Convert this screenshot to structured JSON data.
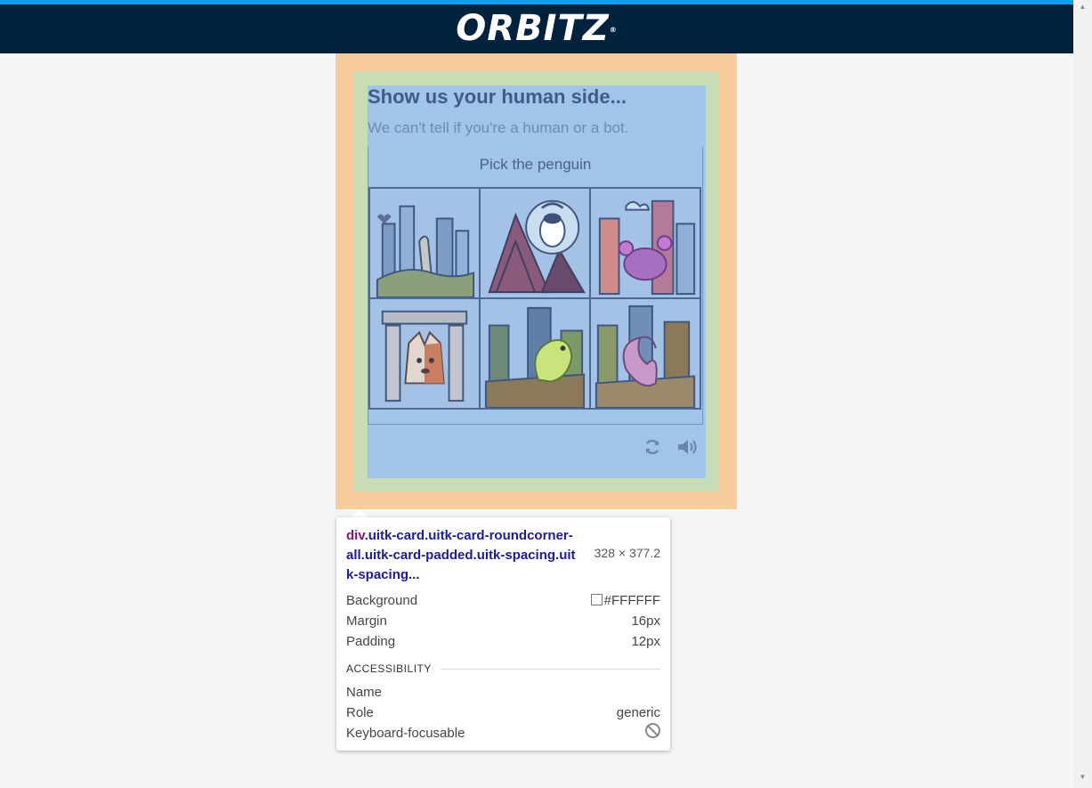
{
  "header": {
    "logo_text": "ORBITZ",
    "logo_mark": "®",
    "bg_color": "#00223c",
    "accent_color": "#0a9ef0"
  },
  "captcha": {
    "title": "Show us your human side...",
    "subtitle": "We can't tell if you're a human or a bot.",
    "prompt": "Pick the penguin",
    "tiles": [
      "tile-1",
      "tile-2",
      "tile-3",
      "tile-4",
      "tile-5",
      "tile-6"
    ],
    "reload_icon": "reload-icon",
    "audio_icon": "audio-icon"
  },
  "overlay": {
    "margin_color": "#f7cc9d",
    "padding_color": "#c6ddb5",
    "content_color": "#a1c4e9"
  },
  "tooltip": {
    "tag": "div",
    "classes": ".uitk-card.uitk-card-roundcorner-all.uitk-card-padded.uitk-spacing.uitk-spacing...",
    "dimensions": "328 × 377.2",
    "props": [
      {
        "label": "Background",
        "value": "#FFFFFF"
      },
      {
        "label": "Margin",
        "value": "16px"
      },
      {
        "label": "Padding",
        "value": "12px"
      }
    ],
    "accessibility_heading": "ACCESSIBILITY",
    "a11y": [
      {
        "label": "Name",
        "value": ""
      },
      {
        "label": "Role",
        "value": "generic"
      },
      {
        "label": "Keyboard-focusable",
        "value": ""
      }
    ]
  }
}
